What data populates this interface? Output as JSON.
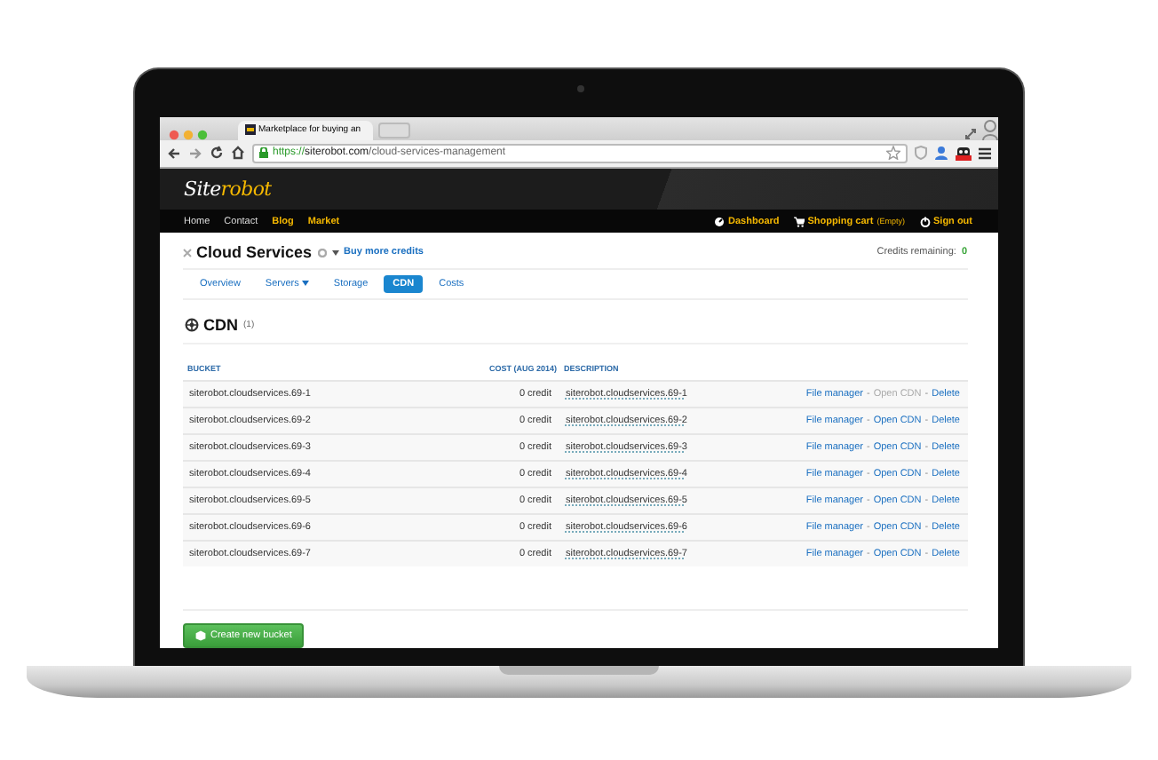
{
  "browser": {
    "tab_title": "Marketplace for buying an",
    "url": {
      "scheme": "https://",
      "host": "siterobot.com",
      "path": "/cloud-services-management"
    }
  },
  "site": {
    "logo": {
      "first": "Site",
      "second": "robot"
    },
    "nav_left": [
      {
        "label": "Home",
        "highlighted": false
      },
      {
        "label": "Contact",
        "highlighted": false
      },
      {
        "label": "Blog",
        "highlighted": true
      },
      {
        "label": "Market",
        "highlighted": true
      }
    ],
    "nav_right": [
      {
        "kind": "dashboard",
        "label": "Dashboard"
      },
      {
        "kind": "cart",
        "label": "Shopping cart",
        "note": "(Empty)"
      },
      {
        "kind": "signout",
        "label": "Sign out"
      }
    ]
  },
  "page": {
    "title": "Cloud Services",
    "buy_link": "Buy more credits",
    "credits_label": "Credits remaining:",
    "credits_value": "0",
    "tabs": [
      {
        "label": "Overview",
        "selected": false,
        "dropdown": false
      },
      {
        "label": "Servers",
        "selected": false,
        "dropdown": true
      },
      {
        "label": "Storage",
        "selected": false,
        "dropdown": false
      },
      {
        "label": "CDN",
        "selected": true,
        "dropdown": false
      },
      {
        "label": "Costs",
        "selected": false,
        "dropdown": false
      }
    ],
    "section": {
      "title": "CDN",
      "count": "(1)"
    },
    "table": {
      "columns": [
        "BUCKET",
        "COST (AUG 2014)",
        "DESCRIPTION"
      ],
      "rows": [
        {
          "bucket": "siterobot.cloudservices.69-1",
          "cost": "0 credit",
          "description": "siterobot.cloudservices.69-1",
          "actions": [
            {
              "kind": "link",
              "label": "File manager",
              "disabled": false
            },
            {
              "kind": "separator",
              "label": "-"
            },
            {
              "kind": "link",
              "label": "Open CDN",
              "disabled": true
            },
            {
              "kind": "separator",
              "label": "-"
            },
            {
              "kind": "link",
              "label": "Delete",
              "disabled": false
            }
          ]
        },
        {
          "bucket": "siterobot.cloudservices.69-2",
          "cost": "0 credit",
          "description": "siterobot.cloudservices.69-2",
          "actions": [
            {
              "kind": "link",
              "label": "File manager",
              "disabled": false
            },
            {
              "kind": "separator",
              "label": "-"
            },
            {
              "kind": "link",
              "label": "Open CDN",
              "disabled": false
            },
            {
              "kind": "separator",
              "label": "-"
            },
            {
              "kind": "link",
              "label": "Delete",
              "disabled": false
            }
          ]
        },
        {
          "bucket": "siterobot.cloudservices.69-3",
          "cost": "0 credit",
          "description": "siterobot.cloudservices.69-3",
          "actions": [
            {
              "kind": "link",
              "label": "File manager",
              "disabled": false
            },
            {
              "kind": "separator",
              "label": "-"
            },
            {
              "kind": "link",
              "label": "Open CDN",
              "disabled": false
            },
            {
              "kind": "separator",
              "label": "-"
            },
            {
              "kind": "link",
              "label": "Delete",
              "disabled": false
            }
          ]
        },
        {
          "bucket": "siterobot.cloudservices.69-4",
          "cost": "0 credit",
          "description": "siterobot.cloudservices.69-4",
          "actions": [
            {
              "kind": "link",
              "label": "File manager",
              "disabled": false
            },
            {
              "kind": "separator",
              "label": "-"
            },
            {
              "kind": "link",
              "label": "Open CDN",
              "disabled": false
            },
            {
              "kind": "separator",
              "label": "-"
            },
            {
              "kind": "link",
              "label": "Delete",
              "disabled": false
            }
          ]
        },
        {
          "bucket": "siterobot.cloudservices.69-5",
          "cost": "0 credit",
          "description": "siterobot.cloudservices.69-5",
          "actions": [
            {
              "kind": "link",
              "label": "File manager",
              "disabled": false
            },
            {
              "kind": "separator",
              "label": "-"
            },
            {
              "kind": "link",
              "label": "Open CDN",
              "disabled": false
            },
            {
              "kind": "separator",
              "label": "-"
            },
            {
              "kind": "link",
              "label": "Delete",
              "disabled": false
            }
          ]
        },
        {
          "bucket": "siterobot.cloudservices.69-6",
          "cost": "0 credit",
          "description": "siterobot.cloudservices.69-6",
          "actions": [
            {
              "kind": "link",
              "label": "File manager",
              "disabled": false
            },
            {
              "kind": "separator",
              "label": "-"
            },
            {
              "kind": "link",
              "label": "Open CDN",
              "disabled": false
            },
            {
              "kind": "separator",
              "label": "-"
            },
            {
              "kind": "link",
              "label": "Delete",
              "disabled": false
            }
          ]
        },
        {
          "bucket": "siterobot.cloudservices.69-7",
          "cost": "0 credit",
          "description": "siterobot.cloudservices.69-7",
          "actions": [
            {
              "kind": "link",
              "label": "File manager",
              "disabled": false
            },
            {
              "kind": "separator",
              "label": "-"
            },
            {
              "kind": "link",
              "label": "Open CDN",
              "disabled": false
            },
            {
              "kind": "separator",
              "label": "-"
            },
            {
              "kind": "link",
              "label": "Delete",
              "disabled": false
            }
          ]
        }
      ]
    },
    "create_button": "Create new bucket"
  }
}
